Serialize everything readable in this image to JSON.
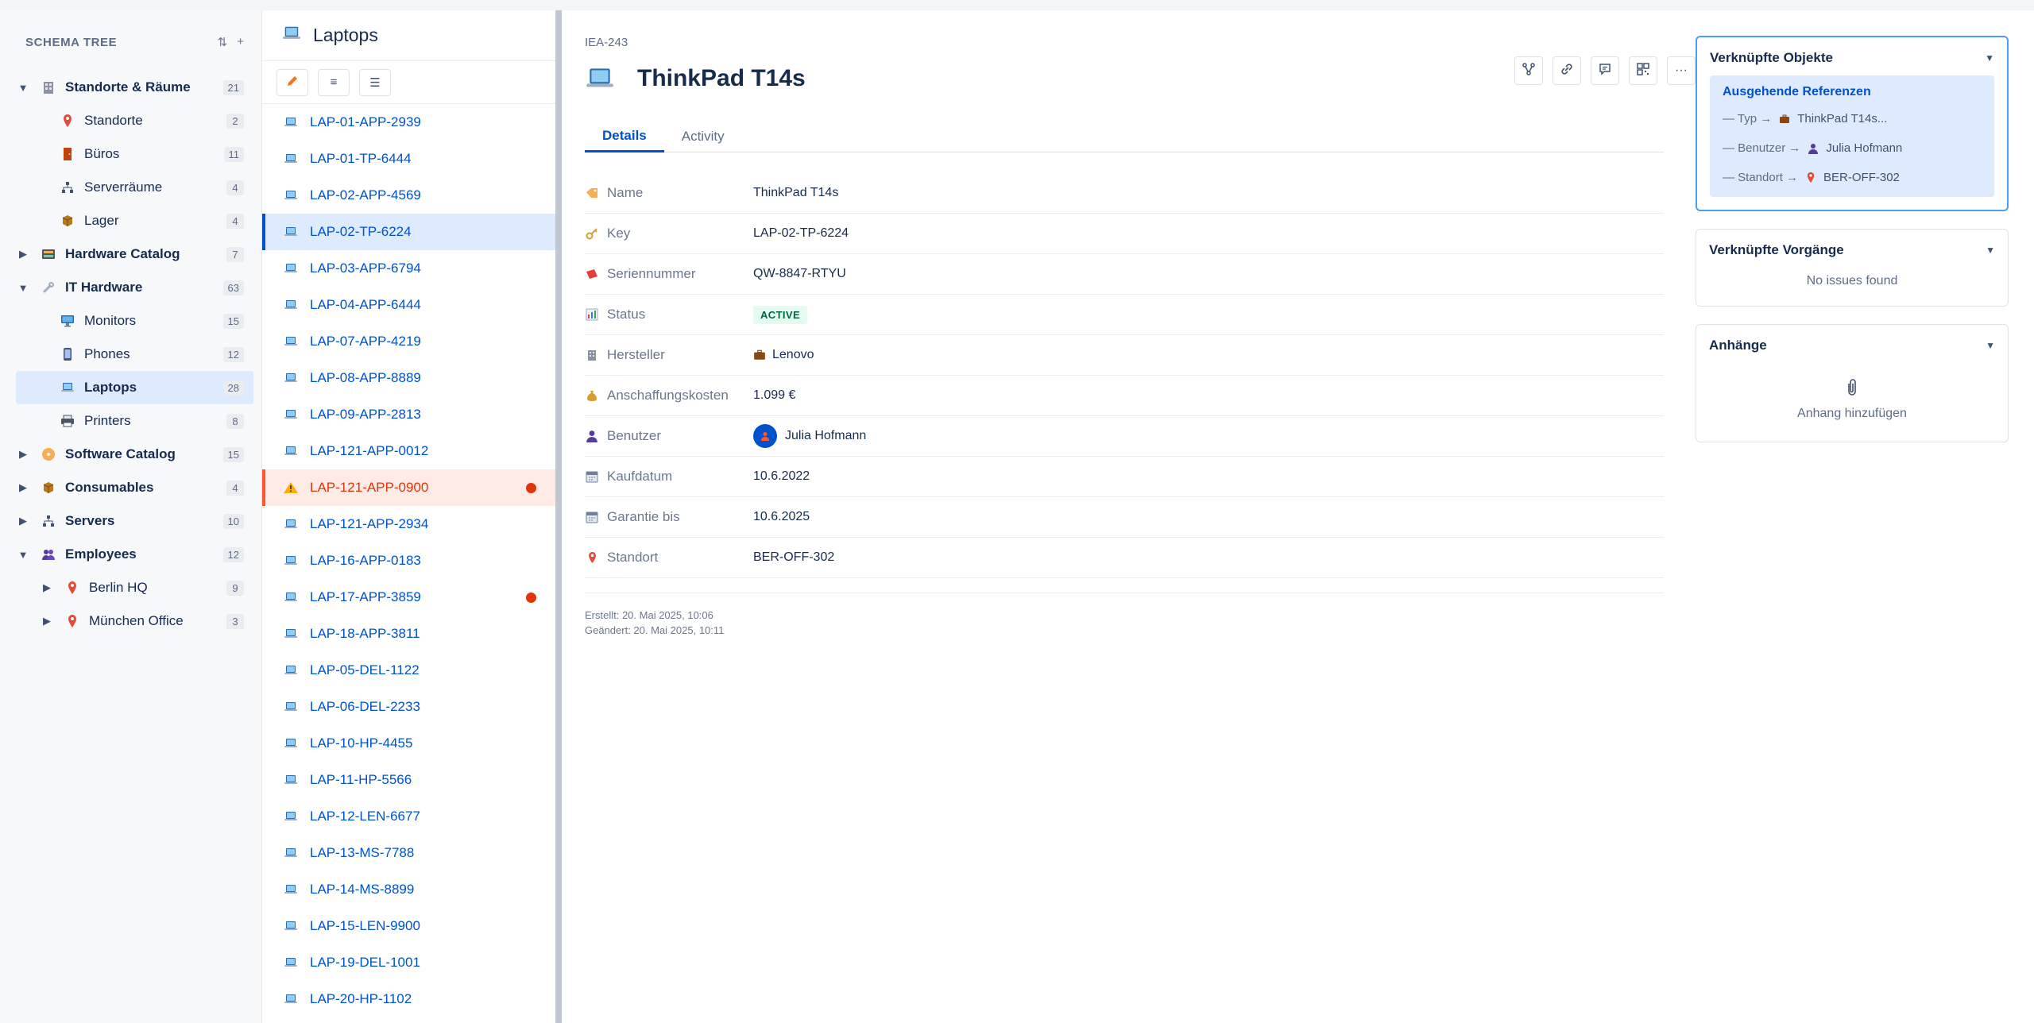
{
  "sidebar": {
    "title": "SCHEMA TREE",
    "sort_icon": "sort-icon",
    "add_icon": "add-icon",
    "items": [
      {
        "label": "Standorte & Räume",
        "count": "21",
        "level": 1,
        "expanded": true,
        "icon": "building-icon"
      },
      {
        "label": "Standorte",
        "count": "2",
        "level": 2,
        "icon": "pin-icon"
      },
      {
        "label": "Büros",
        "count": "11",
        "level": 2,
        "icon": "door-icon"
      },
      {
        "label": "Serverräume",
        "count": "4",
        "level": 2,
        "icon": "network-icon"
      },
      {
        "label": "Lager",
        "count": "4",
        "level": 2,
        "icon": "box-icon"
      },
      {
        "label": "Hardware Catalog",
        "count": "7",
        "level": 1,
        "expanded": false,
        "icon": "catalog-icon"
      },
      {
        "label": "IT Hardware",
        "count": "63",
        "level": 1,
        "expanded": true,
        "icon": "wrench-icon"
      },
      {
        "label": "Monitors",
        "count": "15",
        "level": 2,
        "icon": "monitor-icon"
      },
      {
        "label": "Phones",
        "count": "12",
        "level": 2,
        "icon": "phone-icon"
      },
      {
        "label": "Laptops",
        "count": "28",
        "level": 2,
        "icon": "laptop-icon",
        "selected": true
      },
      {
        "label": "Printers",
        "count": "8",
        "level": 2,
        "icon": "printer-icon"
      },
      {
        "label": "Software Catalog",
        "count": "15",
        "level": 1,
        "expanded": false,
        "icon": "disc-icon"
      },
      {
        "label": "Consumables",
        "count": "4",
        "level": 1,
        "expanded": false,
        "icon": "box-icon"
      },
      {
        "label": "Servers",
        "count": "10",
        "level": 1,
        "expanded": false,
        "icon": "network-icon"
      },
      {
        "label": "Employees",
        "count": "12",
        "level": 1,
        "expanded": true,
        "icon": "people-icon"
      },
      {
        "label": "Berlin HQ",
        "count": "9",
        "level": 3,
        "icon": "pin-icon"
      },
      {
        "label": "München Office",
        "count": "3",
        "level": 3,
        "icon": "pin-icon"
      }
    ]
  },
  "list": {
    "title": "Laptops",
    "rows": [
      {
        "label": "LAP-01-APP-2939"
      },
      {
        "label": "LAP-01-TP-6444"
      },
      {
        "label": "LAP-02-APP-4569"
      },
      {
        "label": "LAP-02-TP-6224",
        "selected": true
      },
      {
        "label": "LAP-03-APP-6794"
      },
      {
        "label": "LAP-04-APP-6444"
      },
      {
        "label": "LAP-07-APP-4219"
      },
      {
        "label": "LAP-08-APP-8889"
      },
      {
        "label": "LAP-09-APP-2813"
      },
      {
        "label": "LAP-121-APP-0012"
      },
      {
        "label": "LAP-121-APP-0900",
        "warning": true,
        "alert": true
      },
      {
        "label": "LAP-121-APP-2934"
      },
      {
        "label": "LAP-16-APP-0183"
      },
      {
        "label": "LAP-17-APP-3859",
        "alert": true
      },
      {
        "label": "LAP-18-APP-3811"
      },
      {
        "label": "LAP-05-DEL-1122"
      },
      {
        "label": "LAP-06-DEL-2233"
      },
      {
        "label": "LAP-10-HP-4455"
      },
      {
        "label": "LAP-11-HP-5566"
      },
      {
        "label": "LAP-12-LEN-6677"
      },
      {
        "label": "LAP-13-MS-7788"
      },
      {
        "label": "LAP-14-MS-8899"
      },
      {
        "label": "LAP-15-LEN-9900"
      },
      {
        "label": "LAP-19-DEL-1001"
      },
      {
        "label": "LAP-20-HP-1102"
      }
    ]
  },
  "detail": {
    "key": "IEA-243",
    "title": "ThinkPad T14s",
    "tabs": [
      "Details",
      "Activity"
    ],
    "fields": [
      {
        "label": "Name",
        "value": "ThinkPad T14s",
        "icon": "tag-icon"
      },
      {
        "label": "Key",
        "value": "LAP-02-TP-6224",
        "icon": "key-icon"
      },
      {
        "label": "Seriennummer",
        "value": "QW-8847-RTYU",
        "icon": "ticket-icon"
      },
      {
        "label": "Status",
        "value": "ACTIVE",
        "icon": "chart-icon"
      },
      {
        "label": "Hersteller",
        "value": "Lenovo",
        "icon": "factory-icon"
      },
      {
        "label": "Anschaffungskosten",
        "value": "1.099 €",
        "icon": "money-bag-icon"
      },
      {
        "label": "Benutzer",
        "value": "Julia Hofmann",
        "icon": "user-icon"
      },
      {
        "label": "Kaufdatum",
        "value": "10.6.2022",
        "icon": "calendar-icon"
      },
      {
        "label": "Garantie bis",
        "value": "10.6.2025",
        "icon": "calendar-icon"
      },
      {
        "label": "Standort",
        "value": "BER-OFF-302",
        "icon": "pin-icon"
      }
    ],
    "created": "Erstellt: 20. Mai 2025, 10:06",
    "modified": "Geändert: 20. Mai 2025, 10:11"
  },
  "right": {
    "linked_objects": {
      "title": "Verknüpfte Objekte",
      "section": "Ausgehende Referenzen",
      "refs": [
        {
          "label": "— Typ →",
          "value": "ThinkPad T14s..."
        },
        {
          "label": "— Benutzer →",
          "value": "Julia Hofmann"
        },
        {
          "label": "— Standort →",
          "value": "BER-OFF-302"
        }
      ]
    },
    "linked_issues": {
      "title": "Verknüpfte Vorgänge",
      "empty": "No issues found"
    },
    "attachments": {
      "title": "Anhänge",
      "action": "Anhang hinzufügen"
    }
  },
  "colors": {
    "accent": "#0052cc",
    "warning": "#de350b",
    "selected_bg": "#deebff",
    "active_badge": "#006644"
  }
}
